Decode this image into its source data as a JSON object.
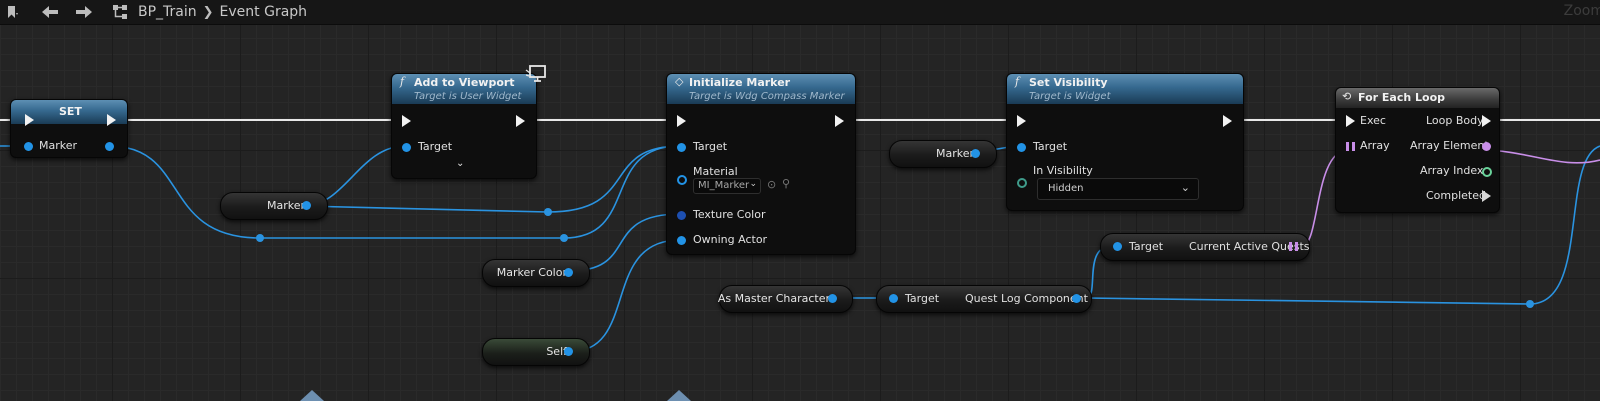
{
  "topbar": {
    "blueprint": "BP_Train",
    "graph": "Event Graph",
    "zoom": "Zoom"
  },
  "nodes": {
    "set": {
      "title": "SET",
      "pin": "Marker"
    },
    "add_to_viewport": {
      "title": "Add to Viewport",
      "subtitle": "Target is User Widget",
      "pin_target": "Target"
    },
    "initialize_marker": {
      "title": "Initialize Marker",
      "subtitle": "Target is Wdg Compass Marker",
      "pin_target": "Target",
      "pin_material": "Material",
      "material_value": "MI_Marker",
      "pin_texture_color": "Texture Color",
      "pin_owning_actor": "Owning Actor"
    },
    "set_visibility": {
      "title": "Set Visibility",
      "subtitle": "Target is Widget",
      "pin_target": "Target",
      "pin_in_visibility": "In Visibility",
      "visibility_value": "Hidden"
    },
    "for_each_loop": {
      "title": "For Each Loop",
      "pin_exec": "Exec",
      "pin_loop_body": "Loop Body",
      "pin_array": "Array",
      "pin_array_element": "Array Element",
      "pin_array_index": "Array Index",
      "pin_completed": "Completed"
    },
    "current_active_quests": {
      "pin_target": "Target",
      "pin_out": "Current Active Quests"
    },
    "quest_log_component": {
      "pin_target": "Target",
      "pin_out": "Quest Log Component"
    }
  },
  "variables": {
    "marker_1": "Marker",
    "marker_2": "Marker",
    "marker_color": "Marker Color",
    "self": "Self",
    "as_master_character": "As Master Character"
  },
  "colors": {
    "object_pin": "#2293e6",
    "exec_wire": "#e8e8e8",
    "array_pin": "#c88ee8",
    "header_blue": "#35688e"
  }
}
